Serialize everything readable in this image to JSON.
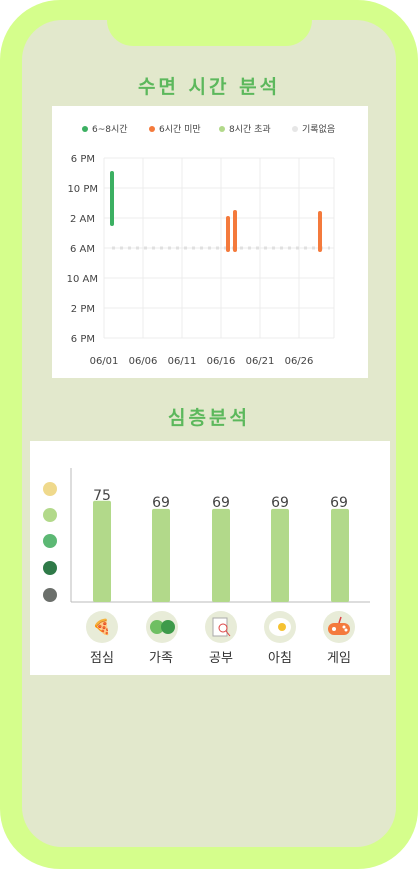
{
  "titles": {
    "sleep": "수면 시간 분석",
    "deep": "심층분석"
  },
  "legend": [
    {
      "label": "6~8시간",
      "color": "#3cb062"
    },
    {
      "label": "6시간 미만",
      "color": "#f47a3c"
    },
    {
      "label": "8시간 초과",
      "color": "#b2d98a"
    },
    {
      "label": "기록없음",
      "color": "#e6e6e6"
    }
  ],
  "sleep_chart": {
    "y_ticks": [
      "6 PM",
      "10 PM",
      "2 AM",
      "6 AM",
      "10 AM",
      "2 PM",
      "6 PM"
    ],
    "x_ticks": [
      "06/01",
      "06/06",
      "06/11",
      "06/16",
      "06/21",
      "06/26"
    ]
  },
  "bars": {
    "values": [
      75,
      69,
      69,
      69,
      69
    ],
    "labels": [
      "점심",
      "가족",
      "공부",
      "아침",
      "게임"
    ],
    "icons": [
      "pizza-icon",
      "family-icon",
      "study-icon",
      "egg-icon",
      "gamepad-icon"
    ],
    "legend_colors": [
      "#efd98c",
      "#b2d98a",
      "#5cb874",
      "#2f7a48",
      "#6b6f6b"
    ]
  },
  "chart_data": [
    {
      "type": "bar",
      "title": "수면 시간 분석",
      "legend": [
        "6~8시간",
        "6시간 미만",
        "8시간 초과",
        "기록없음"
      ],
      "y_ticks": [
        "6 PM",
        "10 PM",
        "2 AM",
        "6 AM",
        "10 AM",
        "2 PM",
        "6 PM"
      ],
      "x_ticks": [
        "06/01",
        "06/06",
        "06/11",
        "06/16",
        "06/21",
        "06/26"
      ],
      "sleep_ranges": [
        {
          "date": "06/01",
          "start": "8:30 PM",
          "end": "3:00 AM",
          "category": "6~8시간"
        },
        {
          "date": "06/16",
          "start": "2:00 AM",
          "end": "6:00 AM",
          "category": "6시간 미만"
        },
        {
          "date": "06/17",
          "start": "1:00 AM",
          "end": "6:00 AM",
          "category": "6시간 미만"
        },
        {
          "date": "06/29",
          "start": "1:00 AM",
          "end": "6:00 AM",
          "category": "6시간 미만"
        }
      ]
    },
    {
      "type": "bar",
      "title": "심층분석",
      "categories": [
        "점심",
        "가족",
        "공부",
        "아침",
        "게임"
      ],
      "values": [
        75,
        69,
        69,
        69,
        69
      ]
    }
  ]
}
